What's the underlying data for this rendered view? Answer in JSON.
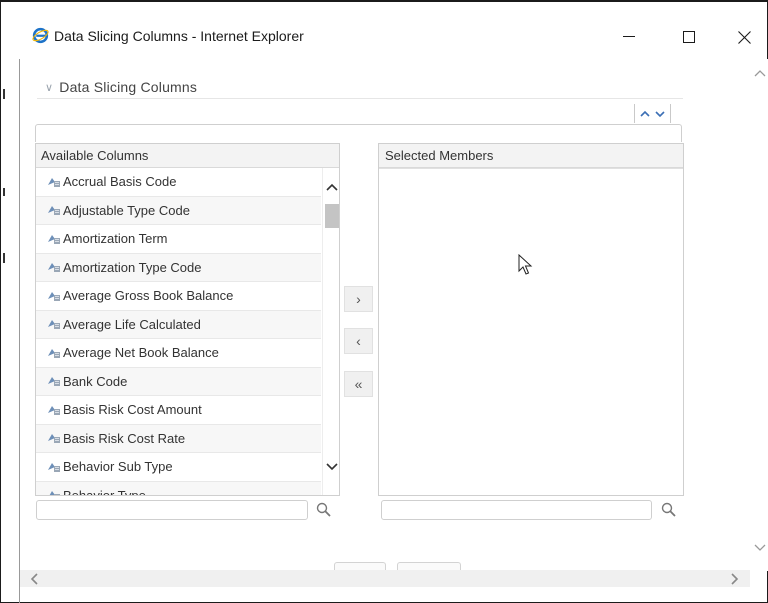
{
  "window": {
    "title": "Data Slicing Columns - Internet Explorer",
    "icon": "internet-explorer-icon"
  },
  "section": {
    "header": "Data Slicing Columns"
  },
  "available": {
    "header": "Available Columns",
    "items": [
      "Accrual Basis Code",
      "Adjustable Type Code",
      "Amortization Term",
      "Amortization Type Code",
      "Average Gross Book Balance",
      "Average Life Calculated",
      "Average Net Book Balance",
      "Bank Code",
      "Basis Risk Cost Amount",
      "Basis Risk Cost Rate",
      "Behavior Sub Type",
      "Behavior Type"
    ],
    "search_value": ""
  },
  "selected": {
    "header": "Selected Members",
    "items": [],
    "search_value": ""
  },
  "move": {
    "right": "›",
    "left": "‹",
    "all_left": "«"
  },
  "colors": {
    "ie_blue": "#1e73c8",
    "border": "#cfcfcf",
    "header_bg": "#f3f3f3",
    "scroll_thumb": "#c4c4c4"
  }
}
